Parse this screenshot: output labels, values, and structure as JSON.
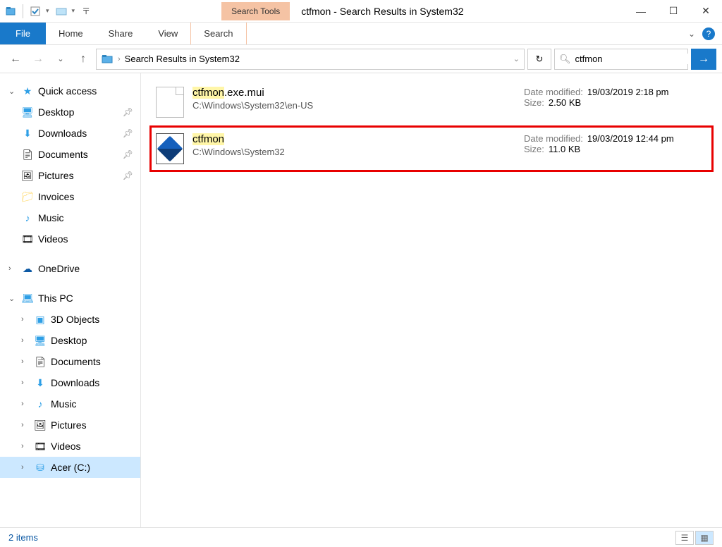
{
  "window": {
    "title": "ctfmon - Search Results in System32",
    "search_tools_label": "Search Tools"
  },
  "ribbon": {
    "file": "File",
    "home": "Home",
    "share": "Share",
    "view": "View",
    "search": "Search"
  },
  "nav": {
    "breadcrumb_text": "Search Results in System32",
    "search_value": "ctfmon"
  },
  "sidebar": {
    "quick_access": "Quick access",
    "desktop": "Desktop",
    "downloads": "Downloads",
    "documents": "Documents",
    "pictures": "Pictures",
    "invoices": "Invoices",
    "music": "Music",
    "videos": "Videos",
    "onedrive": "OneDrive",
    "this_pc": "This PC",
    "objects_3d": "3D Objects",
    "desktop2": "Desktop",
    "documents2": "Documents",
    "downloads2": "Downloads",
    "music2": "Music",
    "pictures2": "Pictures",
    "videos2": "Videos",
    "drive_c": "Acer (C:)"
  },
  "labels": {
    "date_modified": "Date modified:",
    "size": "Size:"
  },
  "results": [
    {
      "name_hl": "ctfmon",
      "name_rest": ".exe.mui",
      "path": "C:\\Windows\\System32\\en-US",
      "date": "19/03/2019 2:18 pm",
      "size": "2.50 KB"
    },
    {
      "name_hl": "ctfmon",
      "name_rest": "",
      "path": "C:\\Windows\\System32",
      "date": "19/03/2019 12:44 pm",
      "size": "11.0 KB"
    }
  ],
  "status": {
    "items": "2 items"
  }
}
